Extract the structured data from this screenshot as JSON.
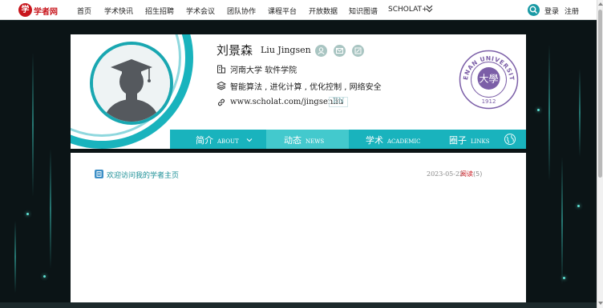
{
  "site": {
    "logo_glyph": "学",
    "name": "学者网"
  },
  "nav": [
    "首页",
    "学术快讯",
    "招生招聘",
    "学术会议",
    "团队协作",
    "课程平台",
    "开放数据",
    "知识图谱",
    "SCHOLAT+"
  ],
  "auth": {
    "login": "登录",
    "register": "注册"
  },
  "profile": {
    "name_cn": "刘景森",
    "name_en": "Liu Jingsen",
    "affiliation": "河南大学 软件学院",
    "research": "智能算法 , 进化计算 , 优化控制 , 网络安全",
    "url": "www.scholat.com/jingsenliu",
    "lang_toggle": "EN"
  },
  "university_logo": {
    "arc_text": "HENAN UNIVERSITY",
    "seal": "大學",
    "year": "1912"
  },
  "tabs": [
    {
      "cn": "简介",
      "en": "ABOUT"
    },
    {
      "cn": "动态",
      "en": "NEWS"
    },
    {
      "cn": "学术",
      "en": "ACADEMIC"
    },
    {
      "cn": "圈子",
      "en": "LINKS"
    }
  ],
  "posts": [
    {
      "title": "欢迎访问我的学者主页",
      "date": "2023-05-22",
      "read_label": "阅读",
      "read_count": "(5)"
    }
  ],
  "colors": {
    "accent": "#19b3bd",
    "accent_light": "#43c9cd",
    "brand_red": "#c8161d",
    "seal_purple": "#7b5ea7"
  },
  "icons": [
    "search-icon",
    "person-icon",
    "mail-icon",
    "share-icon",
    "building-icon",
    "layers-icon",
    "link-icon",
    "chevron-down-icon",
    "globe-icon",
    "post-icon"
  ]
}
